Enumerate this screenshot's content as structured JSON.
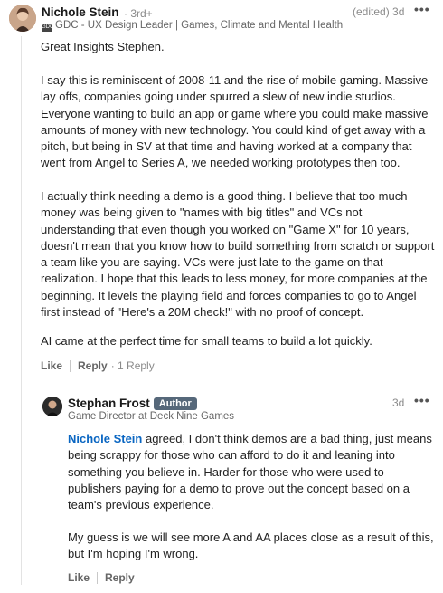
{
  "comment": {
    "author": "Nichole Stein",
    "degree": "· 3rd+",
    "headline": "GDC - UX Design Leader | Games, Climate and Mental Health",
    "timestamp": "(edited) 3d",
    "paragraphs": [
      "Great Insights Stephen.",
      "I say this is reminiscent of 2008-11 and the rise of mobile gaming. Massive lay offs, companies going under spurred a slew of new indie studios. Everyone wanting to build an app or game where you could make massive amounts of money with new technology. You could kind of get away with a pitch, but being in SV at that time and having worked at a company that went from Angel to Series A, we needed working prototypes then too.",
      "I actually think needing a demo is a good thing. I believe that too much money was being given to \"names with big titles\" and VCs not understanding that even though you worked on \"Game X\" for 10 years, doesn't mean that you know how to build something from scratch or support a team like you are saying. VCs were just late to the game on that realization. I hope that this leads to less money, for more companies at the beginning. It levels the playing field and forces companies to go to Angel first instead of \"Here's a 20M check!\" with no proof of concept.",
      "AI came at the perfect time for small teams to build a lot quickly."
    ],
    "like_label": "Like",
    "reply_label": "Reply",
    "reply_count": "· 1 Reply"
  },
  "reply": {
    "author": "Stephan Frost",
    "badge": "Author",
    "headline": "Game Director at Deck Nine Games",
    "timestamp": "3d",
    "mention": "Nichole Stein",
    "paragraph1": " agreed, I don't think demos are a bad thing, just means being scrappy for those who can afford to do it and leaning into something you believe in. Harder for those who were used to publishers paying for a demo to prove out the concept based on a team's previous experience.",
    "paragraph2": "My guess is we will see more A and AA places close as a result of this, but I'm hoping I'm wrong.",
    "like_label": "Like",
    "reply_label": "Reply"
  },
  "colors": {
    "mention": "#0a66c2",
    "badge": "#56687a"
  },
  "icons": [
    "more-options-icon",
    "gdc-logo-icon"
  ]
}
